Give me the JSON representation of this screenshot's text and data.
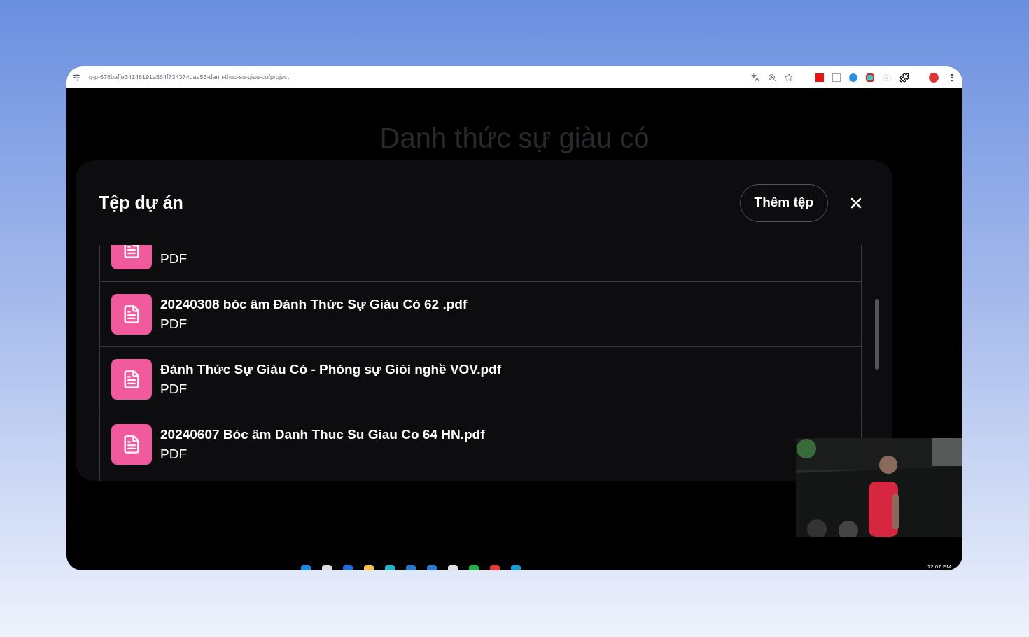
{
  "browser": {
    "address": "g-p-678baffe34148191a564f734374dae53-danh-thuc-su-giau-co/project"
  },
  "page": {
    "title": "Danh thức sự giàu có"
  },
  "dialog": {
    "title": "Tệp dự án",
    "add_button": "Thêm tệp",
    "files": [
      {
        "type": "PDF"
      },
      {
        "name": "20240308 bóc âm Đánh Thức Sự Giàu Có 62 .pdf",
        "type": "PDF"
      },
      {
        "name": "Đánh Thức Sự Giàu Có - Phóng sự Giỏi nghề VOV.pdf",
        "type": "PDF"
      },
      {
        "name": "20240607 Bóc âm Danh Thuc Su Giau Co 64 HN.pdf",
        "type": "PDF"
      }
    ]
  },
  "taskbar": {
    "time": "12:07 PM"
  }
}
